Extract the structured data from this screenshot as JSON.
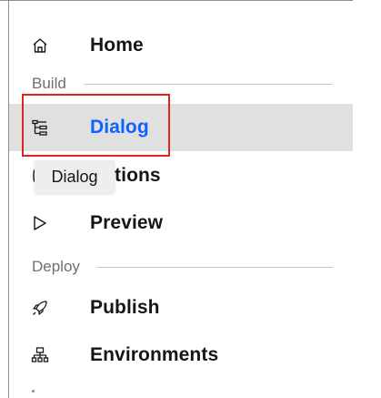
{
  "nav": {
    "home_label": "Home",
    "build_section": "Build",
    "dialog_label": "Dialog",
    "actions_label": "Actions",
    "preview_label": "Preview",
    "deploy_section": "Deploy",
    "publish_label": "Publish",
    "environments_label": "Environments"
  },
  "tooltip": {
    "text": "Dialog"
  },
  "colors": {
    "active_background": "#e0e0e0",
    "active_text": "#0f62fe",
    "highlight_border": "#e02424"
  }
}
